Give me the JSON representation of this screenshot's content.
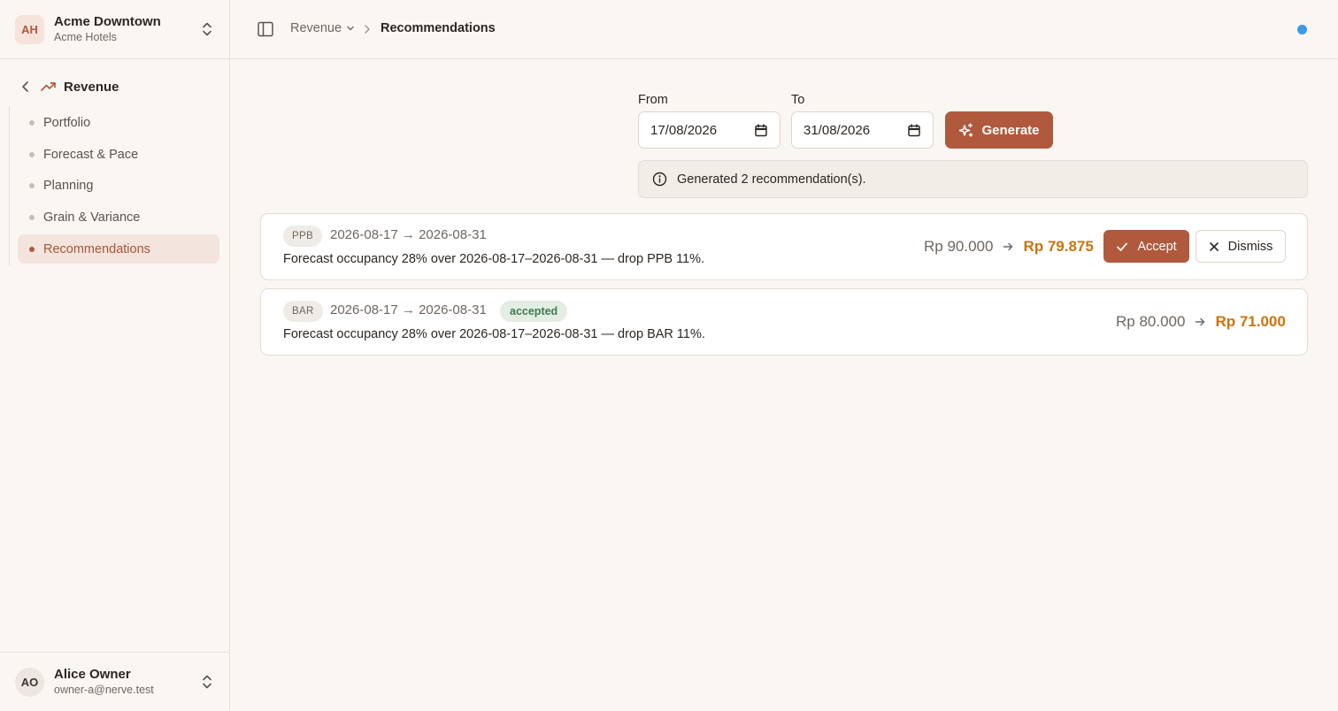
{
  "org": {
    "initials": "AH",
    "name": "Acme Downtown",
    "subtitle": "Acme Hotels"
  },
  "nav": {
    "section": "Revenue",
    "items": [
      {
        "label": "Portfolio"
      },
      {
        "label": "Forecast & Pace"
      },
      {
        "label": "Planning"
      },
      {
        "label": "Grain & Variance"
      },
      {
        "label": "Recommendations"
      }
    ],
    "active": "Recommendations"
  },
  "user": {
    "initials": "AO",
    "name": "Alice Owner",
    "email": "owner-a@nerve.test"
  },
  "breadcrumb": {
    "root": "Revenue",
    "current": "Recommendations"
  },
  "filters": {
    "from_label": "From",
    "from_value": "17/08/2026",
    "to_label": "To",
    "to_value": "31/08/2026",
    "generate_label": "Generate"
  },
  "notice": "Generated 2 recommendation(s).",
  "recommendations": [
    {
      "code": "PPB",
      "range": "2026-08-17 → 2026-08-31",
      "status": "",
      "description": "Forecast occupancy 28% over 2026-08-17–2026-08-31 — drop PPB 11%.",
      "old_price": "Rp 90.000",
      "new_price": "Rp 79.875",
      "accept_label": "Accept",
      "dismiss_label": "Dismiss"
    },
    {
      "code": "BAR",
      "range": "2026-08-17 → 2026-08-31",
      "status": "accepted",
      "description": "Forecast occupancy 28% over 2026-08-17–2026-08-31 — drop BAR 11%.",
      "old_price": "Rp 80.000",
      "new_price": "Rp 71.000"
    }
  ],
  "colors": {
    "accent": "#b0593d",
    "price_new": "#c9740f",
    "status_dot": "#3b9be8",
    "accepted_bg": "#e4ede4",
    "accepted_text": "#3f7a4f"
  }
}
